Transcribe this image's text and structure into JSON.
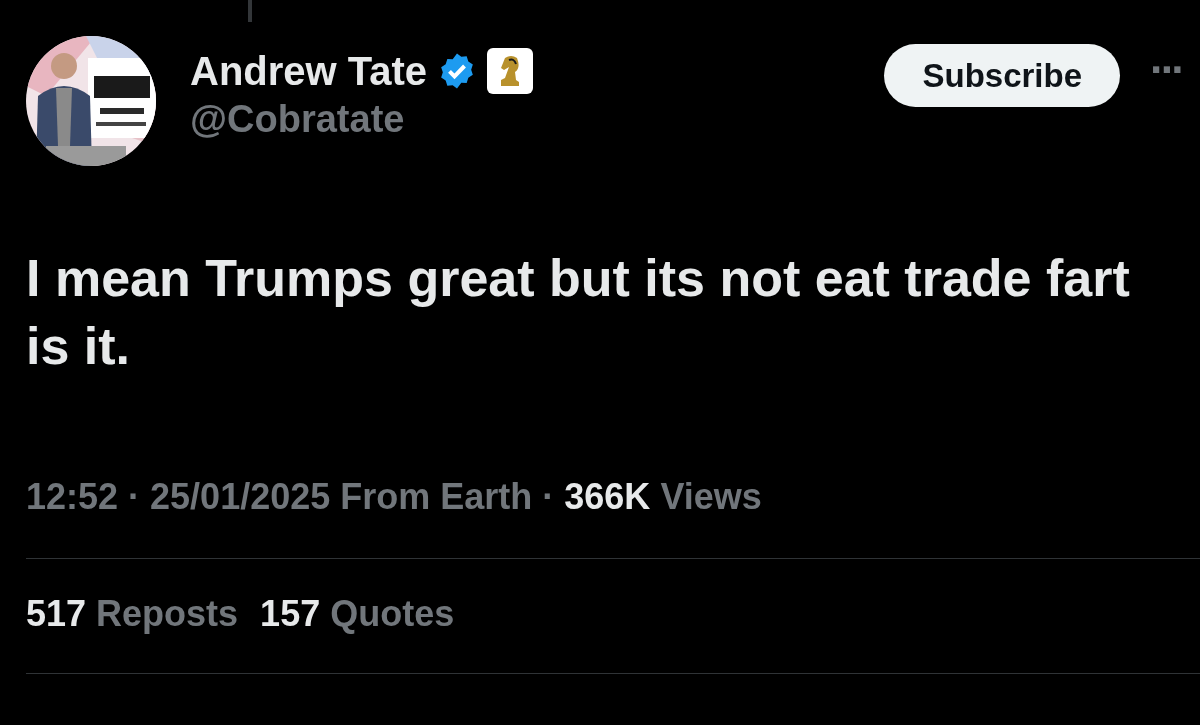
{
  "author": {
    "name": "Andrew Tate",
    "verified": true,
    "handle": "@Cobratate"
  },
  "subscribe_button": {
    "label": "Subscribe"
  },
  "more_menu": {
    "label": "···"
  },
  "post": {
    "text": "I mean Trumps great but its not eat trade fart is it."
  },
  "meta": {
    "time": "12:52",
    "separator": "·",
    "date": "25/01/2025",
    "source": "From Earth",
    "views": {
      "count": "366K",
      "label": "Views"
    }
  },
  "stats": [
    {
      "count": "517",
      "label": "Reposts"
    },
    {
      "count": "157",
      "label": "Quotes"
    }
  ]
}
